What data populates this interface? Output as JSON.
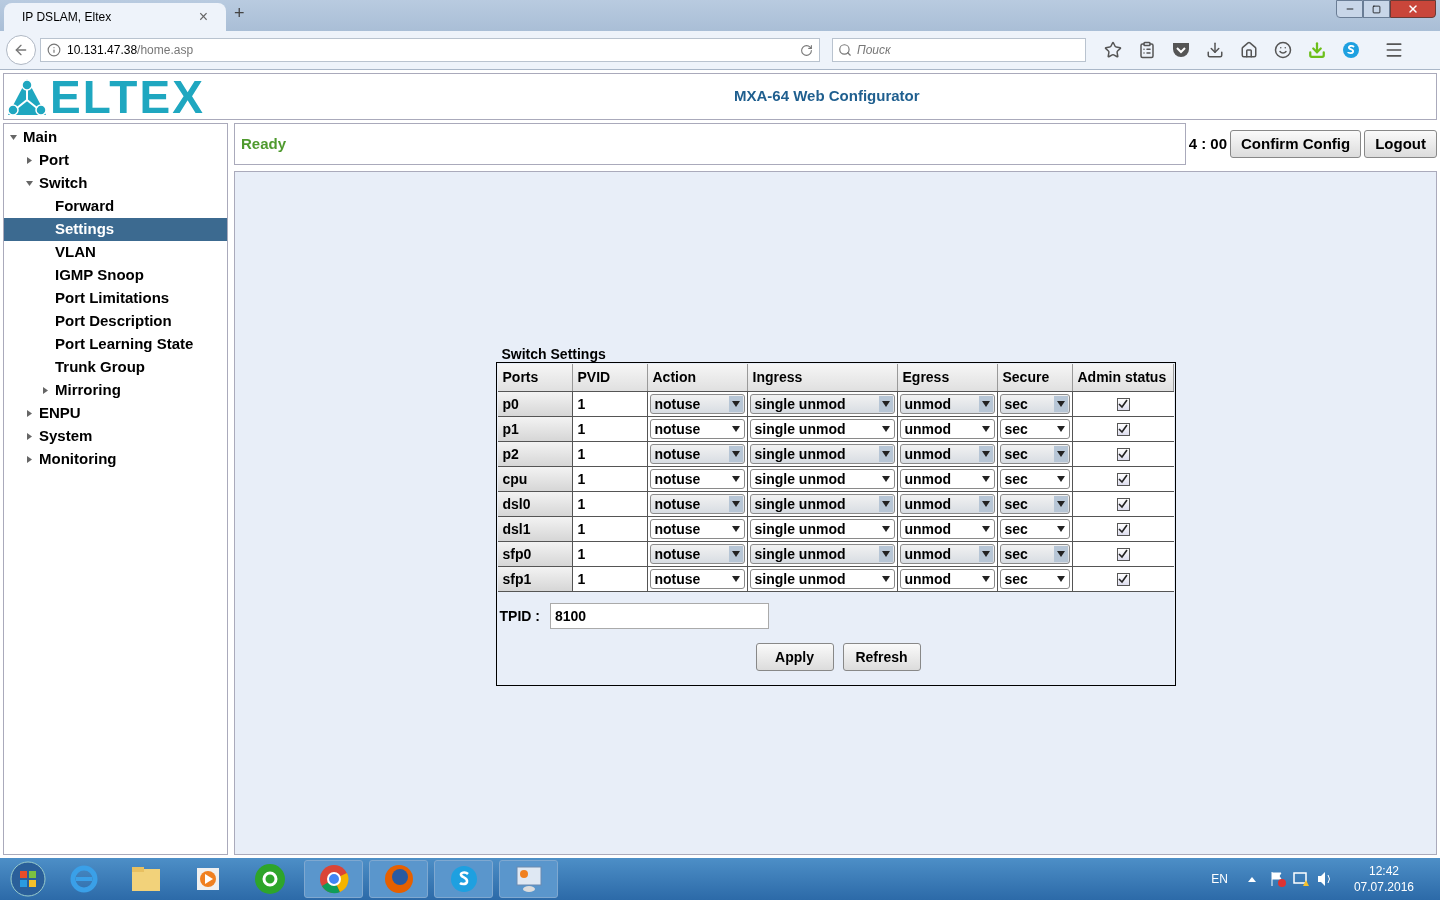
{
  "browser": {
    "tab_title": "IP DSLAM, Eltex",
    "new_tab": "+",
    "close_tab": "×",
    "url_host": "10.131.47.38",
    "url_path": "/home.asp",
    "search_placeholder": "Поиск"
  },
  "header": {
    "logo": "ELTEX",
    "title": "MXA-64 Web Configurator"
  },
  "sidebar": {
    "items": [
      {
        "label": "Main",
        "expanded": true,
        "selected": false,
        "children": [
          {
            "label": "Port",
            "expanded": false,
            "selected": false
          },
          {
            "label": "Switch",
            "expanded": true,
            "selected": false,
            "children": [
              {
                "label": "Forward",
                "selected": false
              },
              {
                "label": "Settings",
                "selected": true
              },
              {
                "label": "VLAN",
                "selected": false
              },
              {
                "label": "IGMP Snoop",
                "selected": false
              },
              {
                "label": "Port Limitations",
                "selected": false
              },
              {
                "label": "Port Description",
                "selected": false
              },
              {
                "label": "Port Learning State",
                "selected": false
              },
              {
                "label": "Trunk Group",
                "selected": false
              },
              {
                "label": "Mirroring",
                "expanded": false,
                "selected": false
              }
            ]
          },
          {
            "label": "ENPU",
            "expanded": false,
            "selected": false
          },
          {
            "label": "System",
            "expanded": false,
            "selected": false
          },
          {
            "label": "Monitoring",
            "expanded": false,
            "selected": false
          }
        ]
      }
    ]
  },
  "status": {
    "message": "Ready",
    "timer": "4 : 00",
    "buttons": [
      "Confirm Config",
      "Logout"
    ]
  },
  "switch_settings": {
    "title": "Switch Settings",
    "columns": [
      "Ports",
      "PVID",
      "Action",
      "Ingress",
      "Egress",
      "Secure",
      "Admin status"
    ],
    "rows": [
      {
        "port": "p0",
        "pvid": "1",
        "action": "notuse",
        "ingress": "single unmod",
        "egress": "unmod",
        "secure": "sec",
        "admin_status": true
      },
      {
        "port": "p1",
        "pvid": "1",
        "action": "notuse",
        "ingress": "single unmod",
        "egress": "unmod",
        "secure": "sec",
        "admin_status": true
      },
      {
        "port": "p2",
        "pvid": "1",
        "action": "notuse",
        "ingress": "single unmod",
        "egress": "unmod",
        "secure": "sec",
        "admin_status": true
      },
      {
        "port": "cpu",
        "pvid": "1",
        "action": "notuse",
        "ingress": "single unmod",
        "egress": "unmod",
        "secure": "sec",
        "admin_status": true
      },
      {
        "port": "dsl0",
        "pvid": "1",
        "action": "notuse",
        "ingress": "single unmod",
        "egress": "unmod",
        "secure": "sec",
        "admin_status": true
      },
      {
        "port": "dsl1",
        "pvid": "1",
        "action": "notuse",
        "ingress": "single unmod",
        "egress": "unmod",
        "secure": "sec",
        "admin_status": true
      },
      {
        "port": "sfp0",
        "pvid": "1",
        "action": "notuse",
        "ingress": "single unmod",
        "egress": "unmod",
        "secure": "sec",
        "admin_status": true
      },
      {
        "port": "sfp1",
        "pvid": "1",
        "action": "notuse",
        "ingress": "single unmod",
        "egress": "unmod",
        "secure": "sec",
        "admin_status": true
      }
    ],
    "tpid_label": "TPID :",
    "tpid_value": "8100",
    "buttons": [
      "Apply",
      "Refresh"
    ]
  },
  "taskbar": {
    "language": "EN",
    "time": "12:42",
    "date": "07.07.2016"
  }
}
